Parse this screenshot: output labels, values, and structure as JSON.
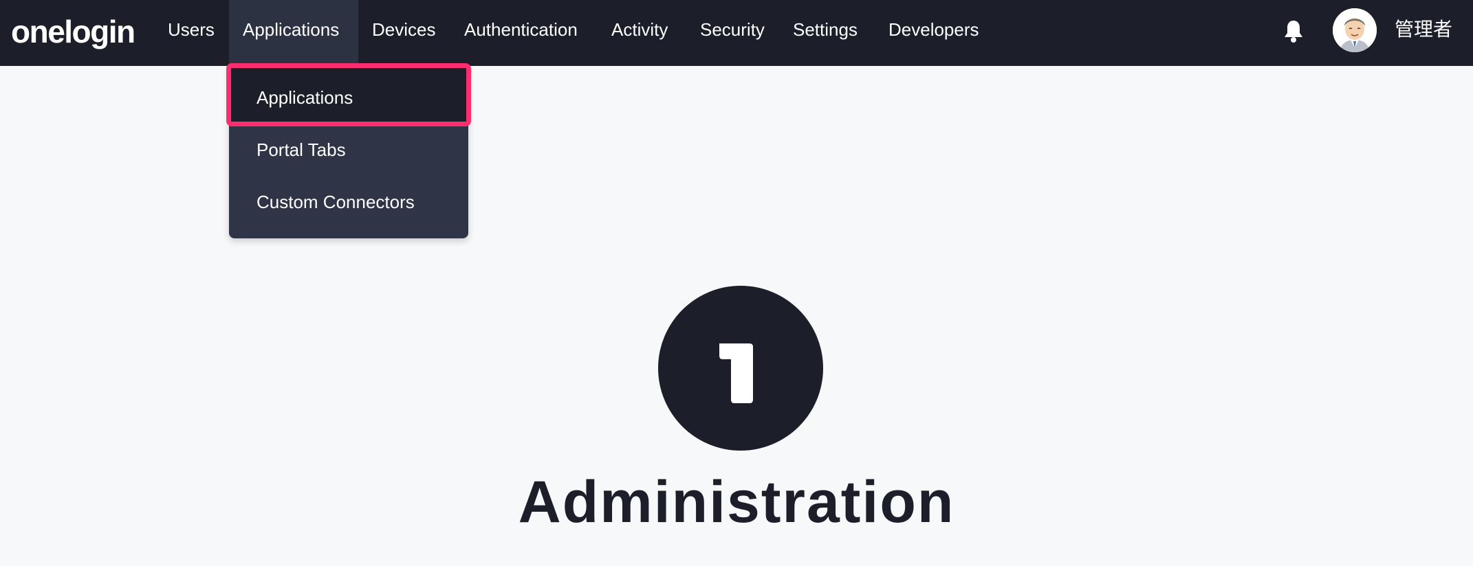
{
  "brand": {
    "logo_text": "onelogin"
  },
  "nav": {
    "items": [
      {
        "label": "Users"
      },
      {
        "label": "Applications"
      },
      {
        "label": "Devices"
      },
      {
        "label": "Authentication"
      },
      {
        "label": "Activity"
      },
      {
        "label": "Security"
      },
      {
        "label": "Settings"
      },
      {
        "label": "Developers"
      }
    ],
    "active": "Applications"
  },
  "header": {
    "user_name": "管理者",
    "notification_icon": "bell-icon",
    "avatar_icon": "user-avatar"
  },
  "dropdown": {
    "items": [
      {
        "label": "Applications"
      },
      {
        "label": "Portal Tabs"
      },
      {
        "label": "Custom Connectors"
      }
    ],
    "highlighted": "Applications"
  },
  "main": {
    "title": "Administration",
    "badge_icon": "onelogin-1-icon"
  },
  "colors": {
    "nav_bg": "#1c1f2a",
    "nav_active": "#2d3243",
    "dropdown_bg": "#2f3446",
    "highlight": "#ff2d6f",
    "page_bg": "#f7f8fa"
  }
}
